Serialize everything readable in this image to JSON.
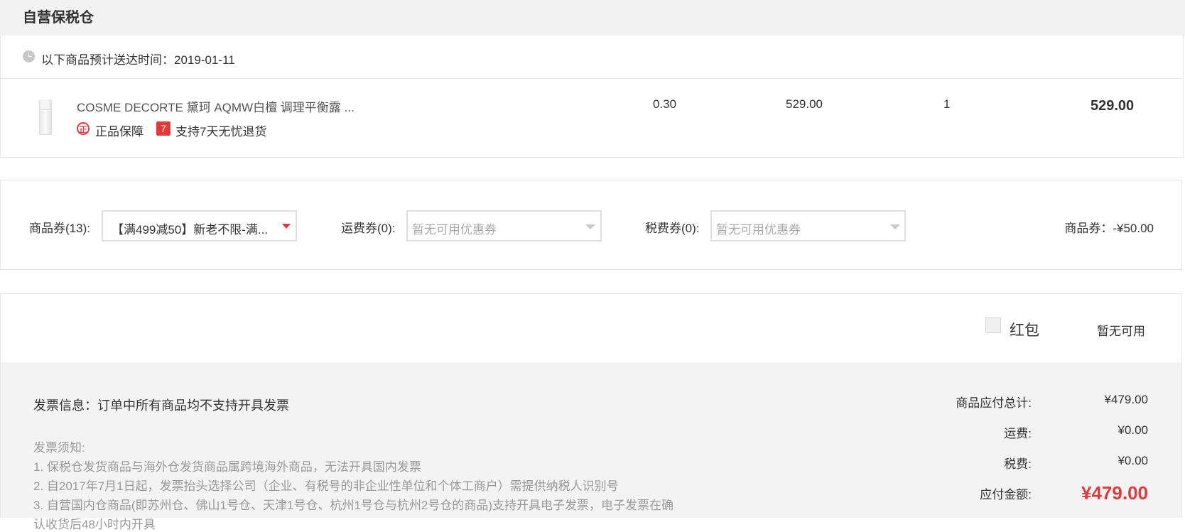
{
  "warehouse": {
    "title": "自营保税仓",
    "delivery_text": "以下商品预计送达时间：2019-01-11"
  },
  "product": {
    "name": "COSME DECORTE 黛珂 AQMW白檀 调理平衡露 ...",
    "badges": [
      {
        "icon": "正",
        "label": "正品保障"
      },
      {
        "icon": "7",
        "label": "支持7天无忧退货"
      }
    ],
    "weight": "0.30",
    "price": "529.00",
    "quantity": "1",
    "subtotal": "529.00"
  },
  "coupons": {
    "goods_label": "商品券(13):",
    "goods_selected": "【满499减50】新老不限-满...",
    "shipping_label": "运费券(0):",
    "shipping_placeholder": "暂无可用优惠券",
    "tax_label": "税费券(0):",
    "tax_placeholder": "暂无可用优惠券",
    "summary": "商品券：-¥50.00"
  },
  "red_packet": {
    "label": "红包",
    "status": "暂无可用"
  },
  "invoice": {
    "info": "发票信息：订单中所有商品均不支持开具发票",
    "notice_title": "发票须知:",
    "notices": [
      "1. 保税仓发货商品与海外仓发货商品属跨境海外商品，无法开具国内发票",
      "2. 自2017年7月1日起，发票抬头选择公司（企业、有税号的非企业性单位和个体工商户）需提供纳税人识别号",
      "3. 自营国内仓商品(即苏州仓、佛山1号仓、天津1号仓、杭州1号仓与杭州2号仓的商品)支持开具电子发票，电子发票在确",
      "认收货后48小时内开具"
    ]
  },
  "summary": {
    "goods_total_label": "商品应付总计:",
    "goods_total": "¥479.00",
    "shipping_label": "运费:",
    "shipping": "¥0.00",
    "tax_label": "税费:",
    "tax": "¥0.00",
    "pay_label": "应付金额:",
    "pay": "¥479.00"
  },
  "colors": {
    "accent": "#e4393c",
    "header_bg": "#f2f2f2",
    "footer_bg": "#f3f3f3"
  }
}
